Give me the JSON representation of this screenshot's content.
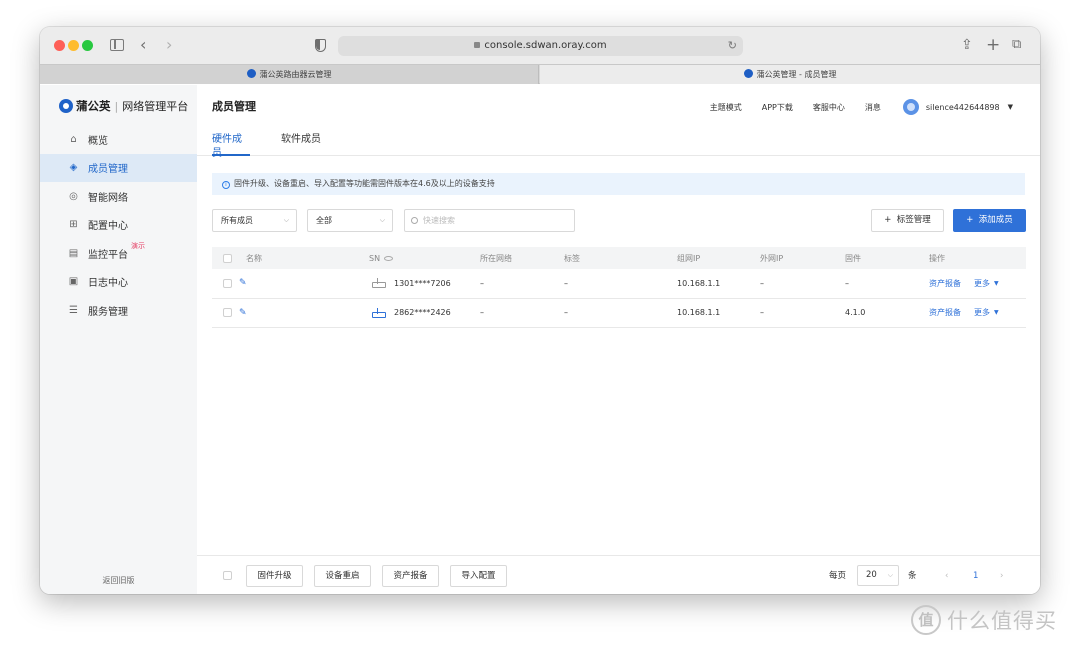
{
  "browser": {
    "url": "console.sdwan.oray.com",
    "tabs": [
      {
        "title": "蒲公英路由器云管理"
      },
      {
        "title": "蒲公英管理 - 成员管理"
      }
    ]
  },
  "sidebar": {
    "brand": "蒲公英",
    "brand_sub": "网络管理平台",
    "items": [
      {
        "label": "概览",
        "icon": "home-icon"
      },
      {
        "label": "成员管理",
        "icon": "layers-icon",
        "active": true
      },
      {
        "label": "智能网络",
        "icon": "network-icon"
      },
      {
        "label": "配置中心",
        "icon": "grid-icon"
      },
      {
        "label": "监控平台",
        "icon": "monitor-icon",
        "tag": "演示"
      },
      {
        "label": "日志中心",
        "icon": "clipboard-icon"
      },
      {
        "label": "服务管理",
        "icon": "document-icon"
      }
    ],
    "footer": "返回旧版"
  },
  "header": {
    "title": "成员管理",
    "theme": "主题模式",
    "app_download": "APP下载",
    "support": "客服中心",
    "messages": "消息",
    "username": "silence442644898"
  },
  "subtabs": [
    "硬件成员",
    "软件成员"
  ],
  "notice": "固件升级、设备重启、导入配置等功能需固件版本在4.6及以上的设备支持",
  "filters": {
    "member_select": "所有成员",
    "type_select": "全部",
    "search_placeholder": "快速搜索"
  },
  "actions": {
    "tag_manage": "标签管理",
    "add_member": "添加成员"
  },
  "table": {
    "columns": [
      "名称",
      "SN",
      "所在网络",
      "标签",
      "组网IP",
      "外网IP",
      "固件",
      "操作"
    ],
    "rows": [
      {
        "sn": "1301****7206",
        "network": "–",
        "tag": "–",
        "lan_ip": "10.168.1.1",
        "wan_ip": "–",
        "firmware": "–",
        "op1": "资产报备",
        "op2": "更多"
      },
      {
        "sn": "2862****2426",
        "network": "–",
        "tag": "–",
        "lan_ip": "10.168.1.1",
        "wan_ip": "–",
        "firmware": "4.1.0",
        "op1": "资产报备",
        "op2": "更多"
      }
    ]
  },
  "footer": {
    "buttons": [
      "固件升级",
      "设备重启",
      "资产报备",
      "导入配置"
    ],
    "per_page_label": "每页",
    "page_size": "20",
    "unit": "条",
    "current_page": "1"
  },
  "watermark": {
    "glyph": "值",
    "text": "什么值得买"
  },
  "colors": {
    "accent": "#2f71d8",
    "active_bg": "#dde9f6",
    "notice_bg": "#eaf3fd"
  }
}
